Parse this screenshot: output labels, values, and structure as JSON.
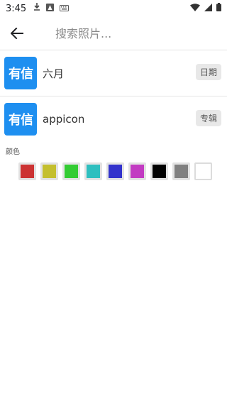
{
  "status_bar": {
    "time": "3:45",
    "icons": [
      "download-icon",
      "app-icon",
      "keyboard-icon"
    ],
    "right_icons": [
      "wifi-icon",
      "signal-icon",
      "battery-icon"
    ]
  },
  "search": {
    "placeholder": "搜索照片..."
  },
  "results": [
    {
      "thumb_text": "有信",
      "title": "六月",
      "badge": "日期"
    },
    {
      "thumb_text": "有信",
      "title": "appicon",
      "badge": "专辑"
    }
  ],
  "colors": {
    "label": "颜色",
    "swatches": [
      "#cc3333",
      "#c4bf2e",
      "#33cc33",
      "#2ebfbf",
      "#3333cc",
      "#c23bc2",
      "#000000",
      "#808080",
      "#ffffff"
    ]
  }
}
